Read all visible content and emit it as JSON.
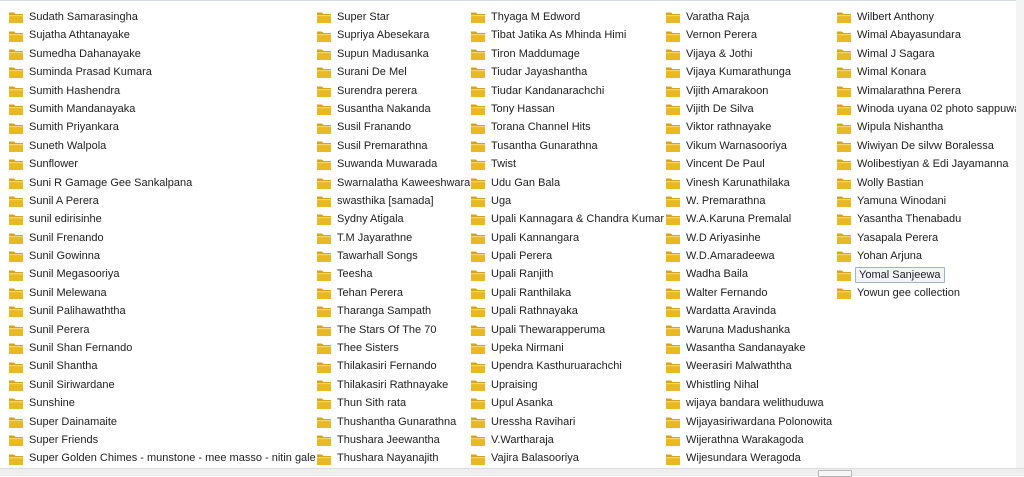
{
  "folder_icon": "folder-icon",
  "folder_color": "#e8b923",
  "selected_item": "Yomal Sanjeewa",
  "columns": [
    [
      "Sudath Samarasingha",
      "Sujatha Athtanayake",
      "Sumedha Dahanayake",
      "Suminda Prasad Kumara",
      "Sumith Hashendra",
      "Sumith Mandanayaka",
      "Sumith Priyankara",
      "Suneth Walpola",
      "Sunflower",
      "Suni R Gamage Gee Sankalpana",
      "Sunil A Perera",
      "sunil edirisinhe",
      "Sunil Frenando",
      "Sunil Gowinna",
      "Sunil Megasooriya",
      "Sunil Melewana",
      "Sunil Palihawaththa",
      "Sunil Perera",
      "Sunil Shan Fernando",
      "Sunil Shantha",
      "Sunil Siriwardane",
      "Sunshine",
      "Super Dainamaite",
      "Super Friends",
      "Super Golden  Chimes - munstone - mee masso - nitin gale"
    ],
    [
      "Super Star",
      "Supriya Abesekara",
      "Supun Madusanka",
      "Surani De Mel",
      "Surendra perera",
      "Susantha Nakanda",
      "Susil Franando",
      "Susil Premarathna",
      "Suwanda Muwarada",
      "Swarnalatha Kaweeshwara",
      "swasthika [samada]",
      "Sydny Atigala",
      "T.M Jayarathne",
      "Tawarhall Songs",
      "Teesha",
      "Tehan Perera",
      "Tharanga Sampath",
      "The Stars Of The 70",
      "Thee Sisters",
      "Thilakasiri Fernando",
      "Thilakasiri Rathnayake",
      "Thun Sith rata",
      "Thushantha Gunarathna",
      "Thushara Jeewantha",
      "Thushara Nayanajith"
    ],
    [
      "Thyaga M Edword",
      "Tibat Jatika As Mhinda Himi",
      "Tiron Maddumage",
      "Tiudar Jayashantha",
      "Tiudar Kandanarachchi",
      "Tony Hassan",
      "Torana Channel Hits",
      "Tusantha Gunarathna",
      "Twist",
      "Udu Gan Bala",
      "Uga",
      "Upali Kannagara & Chandra Kumar",
      "Upali Kannangara",
      "Upali Perera",
      "Upali Ranjith",
      "Upali Ranthilaka",
      "Upali Rathnayaka",
      "Upali Thewarapperuma",
      "Upeka Nirmani",
      "Upendra Kasthuruarachchi",
      "Upraising",
      "Upul Asanka",
      "Uressha Ravihari",
      "V.Wartharaja",
      "Vajira Balasooriya"
    ],
    [
      "Varatha Raja",
      "Vernon Perera",
      "Vijaya & Jothi",
      "Vijaya Kumarathunga",
      "Vijith Amarakoon",
      "Vijith De Silva",
      "Viktor rathnayake",
      "Vikum Warnasooriya",
      "Vincent De Paul",
      "Vinesh Karunathilaka",
      "W. Premarathna",
      "W.A.Karuna Premalal",
      "W.D Ariyasinhe",
      "W.D.Amaradeewa",
      "Wadha Baila",
      "Walter Fernando",
      "Wardatta Aravinda",
      "Waruna Madushanka",
      "Wasantha Sandanayake",
      "Weerasiri Malwaththa",
      "Whistling Nihal",
      "wijaya bandara welithuduwa",
      "Wijayasiriwardana Polonowita",
      "Wijerathna Warakagoda",
      "Wijesundara Weragoda"
    ],
    [
      "Wilbert Anthony",
      "Wimal Abayasundara",
      "Wimal J Sagara",
      "Wimal Konara",
      "Wimalarathna Perera",
      "Winoda uyana 02 photo sappuwa",
      "Wipula Nishantha",
      "Wiwiyan De silvw Boralessa",
      "Wolibestiyan & Edi Jayamanna",
      "Wolly Bastian",
      "Yamuna Winodani",
      "Yasantha Thenabadu",
      "Yasapala Perera",
      "Yohan Arjuna",
      "Yomal Sanjeewa",
      "Yowun gee collection"
    ]
  ]
}
